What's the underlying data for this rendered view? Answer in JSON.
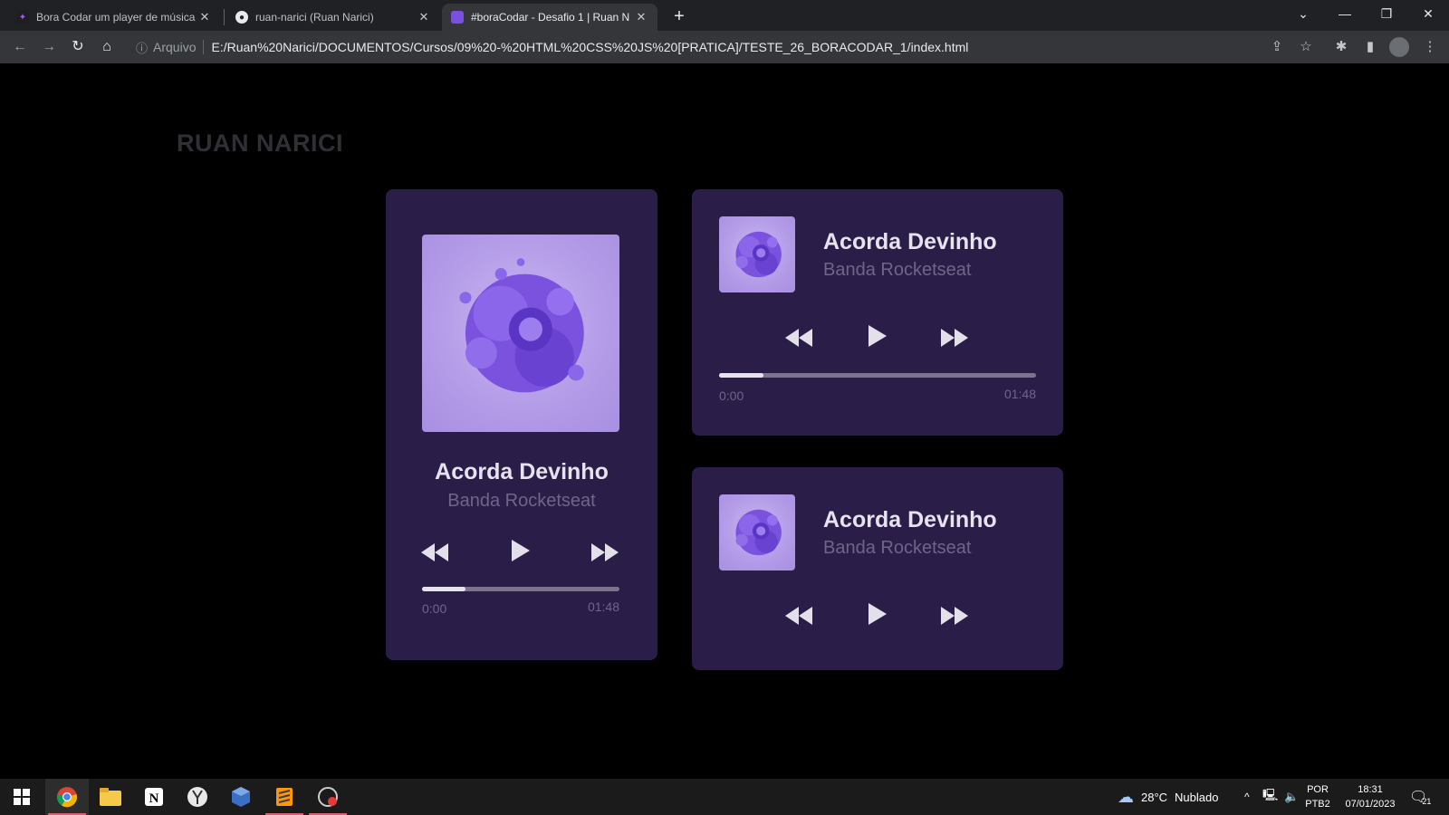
{
  "browser": {
    "tabs": [
      {
        "title": "Bora Codar um player de música",
        "icon": "figma-icon"
      },
      {
        "title": "ruan-narici (Ruan Narici)",
        "icon": "github-icon"
      },
      {
        "title": "#boraCodar - Desafio 1 | Ruan N",
        "icon": "page-favicon-icon"
      }
    ],
    "new_tab_label": "+",
    "address": {
      "scheme_label": "Arquivo",
      "url": "E:/Ruan%20Narici/DOCUMENTOS/Cursos/09%20-%20HTML%20CSS%20JS%20[PRATICA]/TESTE_26_BORACODAR_1/index.html"
    }
  },
  "page": {
    "brand": "RUAN NARICI",
    "players": [
      {
        "variant": "large",
        "title": "Acorda Devinho",
        "artist": "Banda Rocketseat",
        "progress": 0.22,
        "current_time": "0:00",
        "duration": "01:48"
      },
      {
        "variant": "compact-with-progress",
        "title": "Acorda Devinho",
        "artist": "Banda Rocketseat",
        "progress": 0.14,
        "current_time": "0:00",
        "duration": "01:48"
      },
      {
        "variant": "compact",
        "title": "Acorda Devinho",
        "artist": "Banda Rocketseat"
      }
    ]
  },
  "taskbar": {
    "apps": [
      "start-icon",
      "chrome-icon",
      "file-explorer-icon",
      "notion-icon",
      "yandex-icon",
      "virtualbox-icon",
      "sublime-icon",
      "recorder-icon"
    ],
    "weather": {
      "temperature": "28°C",
      "condition": "Nublado",
      "icon": "cloud-icon"
    },
    "language": "POR",
    "keyboard": "PTB2",
    "time": "18:31",
    "date": "07/01/2023",
    "notifications": "21"
  },
  "colors": {
    "card_bg": "#2a1d47",
    "page_bg": "#000000",
    "title": "#e6e3ee",
    "muted": "#6f6589",
    "cover_accent": "#7b4fe0"
  }
}
